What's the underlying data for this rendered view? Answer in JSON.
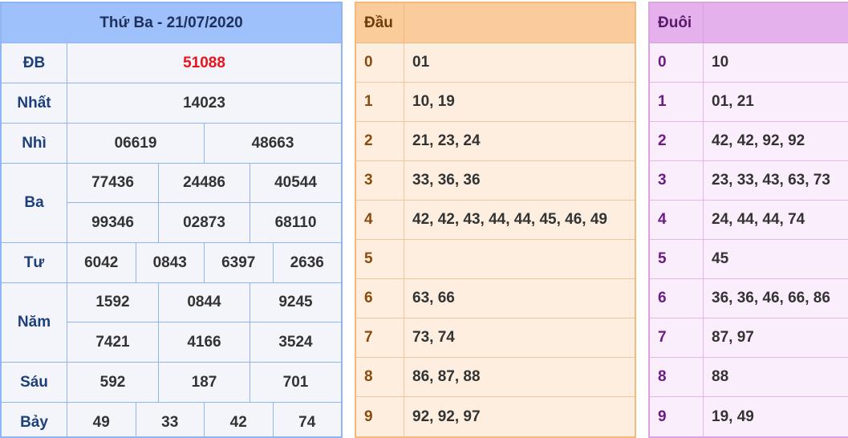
{
  "results": {
    "title": "Thứ Ba - 21/07/2020",
    "prizes": [
      {
        "label": "ĐB",
        "lines": [
          [
            "51088"
          ]
        ],
        "special": true
      },
      {
        "label": "Nhất",
        "lines": [
          [
            "14023"
          ]
        ]
      },
      {
        "label": "Nhì",
        "lines": [
          [
            "06619",
            "48663"
          ]
        ]
      },
      {
        "label": "Ba",
        "lines": [
          [
            "77436",
            "24486",
            "40544"
          ],
          [
            "99346",
            "02873",
            "68110"
          ]
        ]
      },
      {
        "label": "Tư",
        "lines": [
          [
            "6042",
            "0843",
            "6397",
            "2636"
          ]
        ]
      },
      {
        "label": "Năm",
        "lines": [
          [
            "1592",
            "0844",
            "9245"
          ],
          [
            "7421",
            "4166",
            "3524"
          ]
        ]
      },
      {
        "label": "Sáu",
        "lines": [
          [
            "592",
            "187",
            "701"
          ]
        ]
      },
      {
        "label": "Bảy",
        "lines": [
          [
            "49",
            "33",
            "42",
            "74"
          ]
        ]
      }
    ]
  },
  "dau": {
    "header": "Đầu",
    "rows": [
      {
        "k": "0",
        "v": "01"
      },
      {
        "k": "1",
        "v": "10, 19"
      },
      {
        "k": "2",
        "v": "21, 23, 24"
      },
      {
        "k": "3",
        "v": "33, 36, 36"
      },
      {
        "k": "4",
        "v": "42, 42, 43, 44, 44, 45, 46, 49"
      },
      {
        "k": "5",
        "v": ""
      },
      {
        "k": "6",
        "v": "63, 66"
      },
      {
        "k": "7",
        "v": "73, 74"
      },
      {
        "k": "8",
        "v": "86, 87, 88"
      },
      {
        "k": "9",
        "v": "92, 92, 97"
      }
    ]
  },
  "duoi": {
    "header": "Đuôi",
    "rows": [
      {
        "k": "0",
        "v": "10"
      },
      {
        "k": "1",
        "v": "01, 21"
      },
      {
        "k": "2",
        "v": "42, 42, 92, 92"
      },
      {
        "k": "3",
        "v": "23, 33, 43, 63, 73"
      },
      {
        "k": "4",
        "v": "24, 44, 44, 74"
      },
      {
        "k": "5",
        "v": "45"
      },
      {
        "k": "6",
        "v": "36, 36, 46, 66, 86"
      },
      {
        "k": "7",
        "v": "87, 97"
      },
      {
        "k": "8",
        "v": "88"
      },
      {
        "k": "9",
        "v": "19, 49"
      }
    ]
  },
  "colors": {
    "special_number": "#e8141c",
    "results_border": "#8fb6f4",
    "dau_border": "#f5b97c",
    "duoi_border": "#dca3e3"
  }
}
